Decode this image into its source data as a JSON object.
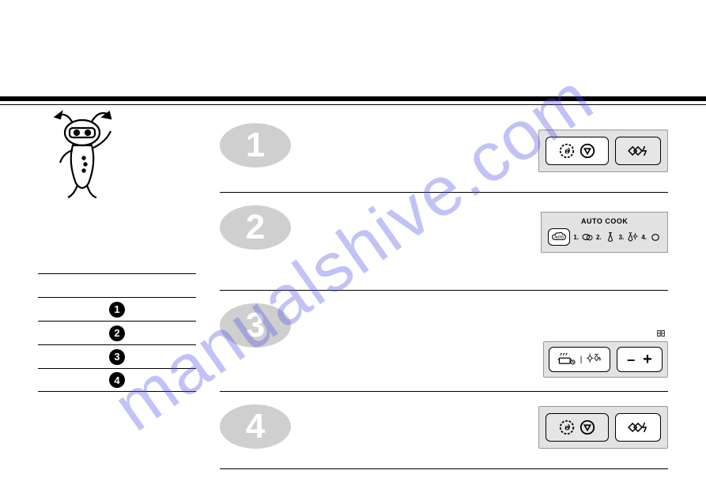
{
  "watermark": "manualshive.com",
  "summary": {
    "rows": [
      "1",
      "2",
      "3",
      "4"
    ]
  },
  "steps": {
    "s1": {
      "num": "1"
    },
    "s2": {
      "num": "2",
      "autocook_label": "AUTO COOK",
      "options": {
        "o1": "1.",
        "o2": "2.",
        "o3": "3.",
        "o4": "4."
      }
    },
    "s3": {
      "num": "3",
      "minus": "–",
      "plus": "+"
    },
    "s4": {
      "num": "4"
    }
  }
}
